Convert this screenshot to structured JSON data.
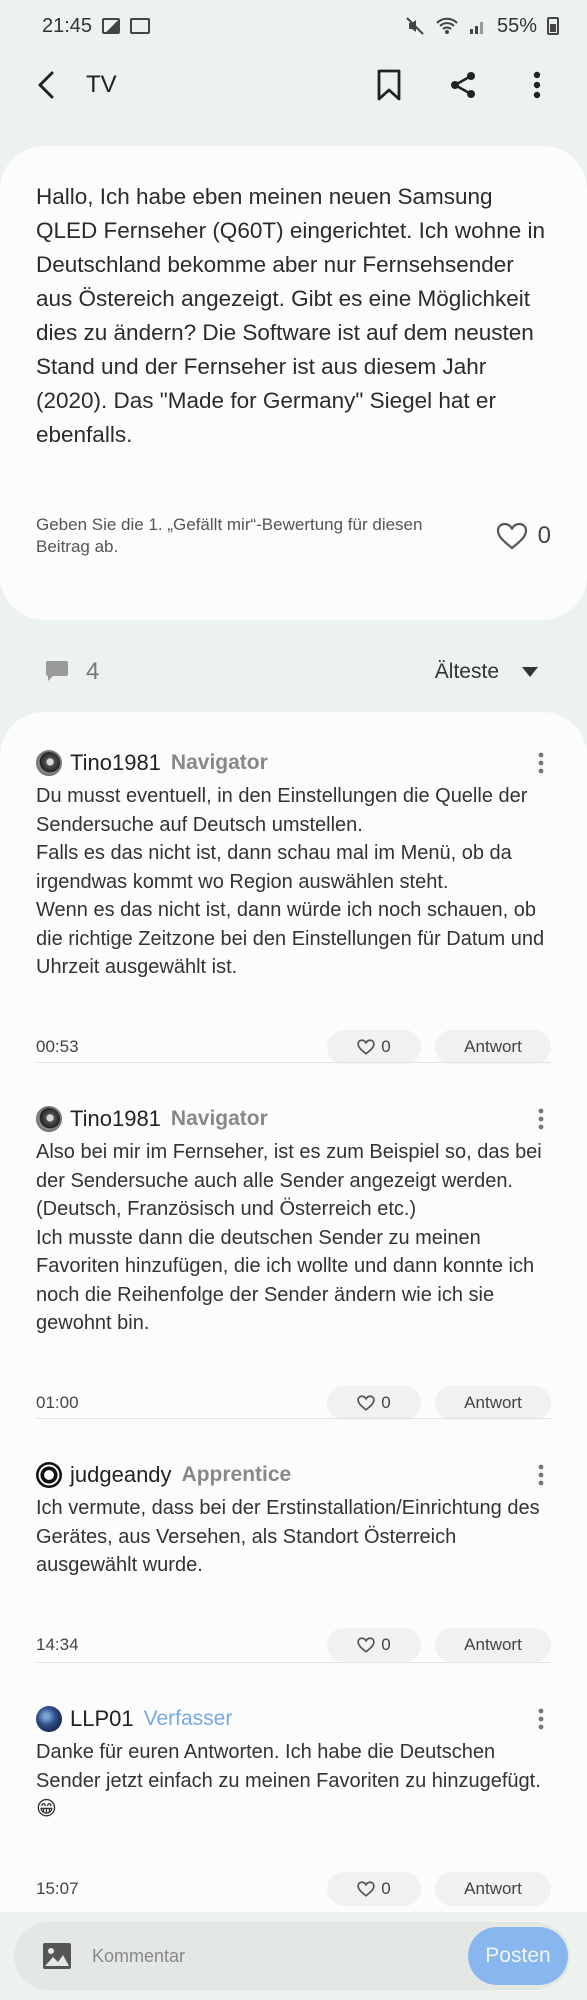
{
  "status_bar": {
    "time": "21:45",
    "battery": "55%"
  },
  "header": {
    "title": "TV"
  },
  "post": {
    "body": "Hallo, Ich habe eben meinen neuen Samsung QLED Fernseher (Q60T) eingerichtet. Ich wohne in Deutschland bekomme aber nur Fernsehsender aus Östereich angezeigt. Gibt es eine Möglichkeit dies zu ändern? Die Software ist auf dem neusten Stand und der Fernseher ist aus diesem Jahr (2020). Das \"Made for Germany\" Siegel hat er ebenfalls.",
    "like_prompt": "Geben Sie die 1. „Gefällt mir“-Bewertung für diesen Beitrag ab.",
    "like_count": "0"
  },
  "comment_bar": {
    "count": "4",
    "sort_label": "Älteste"
  },
  "comments": [
    {
      "user": "Tino1981",
      "rank": "Navigator",
      "text": "Du musst eventuell, in den Einstellungen die Quelle der Sendersuche auf Deutsch umstellen.\nFalls es das nicht ist, dann schau mal im Menü, ob da irgendwas kommt wo Region auswählen steht.\nWenn es das nicht ist, dann würde ich noch schauen, ob die richtige Zeitzone bei den Einstellungen für Datum und Uhrzeit ausgewählt ist.",
      "time": "00:53",
      "likes": "0",
      "reply_label": "Antwort"
    },
    {
      "user": "Tino1981",
      "rank": "Navigator",
      "text": "Also bei mir im Fernseher, ist es zum Beispiel so, das bei der Sendersuche auch alle Sender angezeigt werden.(Deutsch, Französisch und Österreich etc.)\nIch musste dann die deutschen Sender zu meinen Favoriten hinzufügen, die ich wollte und dann konnte ich noch die Reihenfolge der Sender ändern wie ich sie gewohnt bin.",
      "time": "01:00",
      "likes": "0",
      "reply_label": "Antwort"
    },
    {
      "user": "judgeandy",
      "rank": "Apprentice",
      "text": "Ich vermute, dass bei der Erstinstallation/Einrichtung des Gerätes, aus Versehen, als Standort Österreich ausgewählt wurde.",
      "time": "14:34",
      "likes": "0",
      "reply_label": "Antwort"
    },
    {
      "user": "LLP01",
      "rank": "Verfasser",
      "text": "Danke für euren Antworten. Ich habe die Deutschen Sender jetzt einfach zu meinen Favoriten zu hinzugefügt. 😁",
      "time": "15:07",
      "likes": "0",
      "reply_label": "Antwort"
    }
  ],
  "composer": {
    "placeholder": "Kommentar",
    "post_label": "Posten"
  },
  "colors": {
    "accent": "#3e8ff7",
    "author_rank": "#76a9e0",
    "background": "#ecf2ee"
  }
}
